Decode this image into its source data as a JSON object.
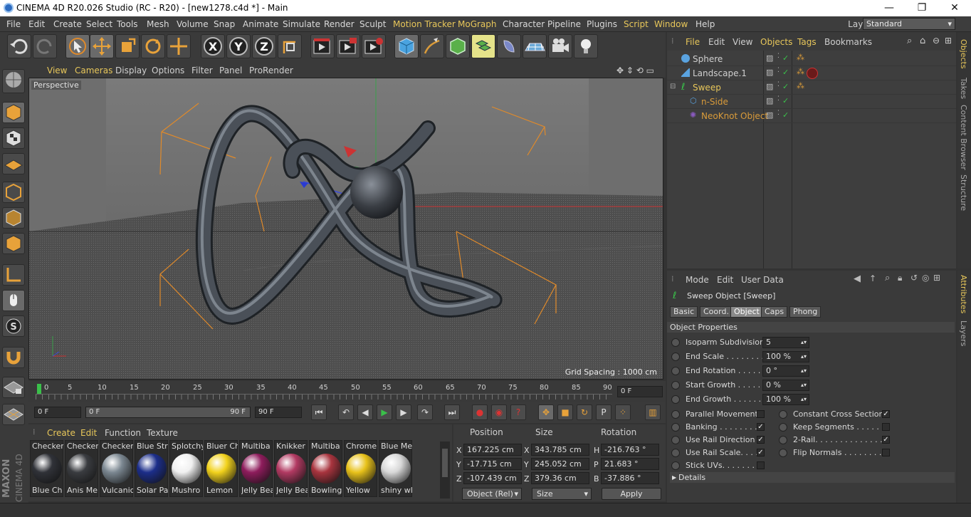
{
  "window": {
    "title": "CINEMA 4D R20.026 Studio (RC - R20) - [new1278.c4d *] - Main",
    "minimize": "—",
    "maximize": "❐",
    "close": "✕"
  },
  "menubar": {
    "items": [
      "File",
      "Edit",
      "Create",
      "Select",
      "Tools",
      "Mesh",
      "Volume",
      "Snap",
      "Animate",
      "Simulate",
      "Render",
      "Sculpt",
      "Motion Tracker",
      "MoGraph",
      "Character",
      "Pipeline",
      "Plugins",
      "Script",
      "Window",
      "Help"
    ],
    "layout_label": "Layout:",
    "layout_value": "Standard"
  },
  "viewport": {
    "menu": [
      "View",
      "Cameras",
      "Display",
      "Options",
      "Filter",
      "Panel",
      "ProRender"
    ],
    "camera_label": "Perspective",
    "grid_spacing": "Grid Spacing : 1000 cm"
  },
  "timeline": {
    "ticks": [
      "0",
      "5",
      "10",
      "15",
      "20",
      "25",
      "30",
      "35",
      "40",
      "45",
      "50",
      "55",
      "60",
      "65",
      "70",
      "75",
      "80",
      "85",
      "90"
    ],
    "current_frame": "0 F"
  },
  "transport": {
    "start": "0 F",
    "range_start": "0 F",
    "range_end": "90 F",
    "end": "90 F"
  },
  "material_manager": {
    "menu": [
      "Create",
      "Edit",
      "Function",
      "Texture"
    ],
    "row1": [
      "Checker",
      "Checker",
      "Checker",
      "Blue Str",
      "Splotchy",
      "Bluer Ch",
      "Multiba",
      "Knikker",
      "Multiba",
      "Chrome",
      "Blue Me"
    ],
    "row2": [
      "Blue Ch",
      "Anis Me",
      "Vulcanic",
      "Solar Pa",
      "Mushro",
      "Lemon",
      "Jelly Bea",
      "Jelly Bea",
      "Bowling",
      "Yellow",
      "shiny wl"
    ],
    "colors": [
      "#303238",
      "#3a3c40",
      "#7b8791",
      "#1c2e8a",
      "#f0f0f0",
      "#f2d21c",
      "#8e1c5c",
      "#b23a62",
      "#a8343e",
      "#e8c21a",
      "#d8d8d8"
    ]
  },
  "coordinates": {
    "headers": {
      "position": "Position",
      "size": "Size",
      "rotation": "Rotation"
    },
    "rows": [
      {
        "axis": "X",
        "pos": "167.225 cm",
        "size_axis": "X",
        "size": "343.785 cm",
        "rot_axis": "H",
        "rot": "-216.763 °"
      },
      {
        "axis": "Y",
        "pos": "-17.715 cm",
        "size_axis": "Y",
        "size": "245.052 cm",
        "rot_axis": "P",
        "rot": "21.683 °"
      },
      {
        "axis": "Z",
        "pos": "-107.439 cm",
        "size_axis": "Z",
        "size": "379.36 cm",
        "rot_axis": "B",
        "rot": "-37.886 °"
      }
    ],
    "mode": "Object (Rel)",
    "size_mode": "Size",
    "apply": "Apply"
  },
  "object_manager": {
    "menu": [
      "File",
      "Edit",
      "View",
      "Objects",
      "Tags",
      "Bookmarks"
    ],
    "objects": [
      {
        "name": "Sphere"
      },
      {
        "name": "Landscape.1"
      },
      {
        "name": "Sweep"
      },
      {
        "name": "n-Side"
      },
      {
        "name": "NeoKnot Object"
      }
    ]
  },
  "attribute_manager": {
    "menu": [
      "Mode",
      "Edit",
      "User Data"
    ],
    "title": "Sweep Object [Sweep]",
    "tabs": [
      "Basic",
      "Coord.",
      "Object",
      "Caps",
      "Phong"
    ],
    "section": "Object Properties",
    "fields": [
      {
        "label": "Isoparm Subdivision",
        "value": "5"
      },
      {
        "label": "End Scale . . . . . . . . .",
        "value": "100 %"
      },
      {
        "label": "End Rotation . . . . . .",
        "value": "0 °"
      },
      {
        "label": "Start Growth . . . . . .",
        "value": "0 %"
      },
      {
        "label": "End Growth . . . . . . .",
        "value": "100 %"
      }
    ],
    "checks_left": [
      {
        "label": "Parallel Movement",
        "checked": false
      },
      {
        "label": "Banking . . . . . . . .",
        "checked": true
      },
      {
        "label": "Use Rail Direction",
        "checked": true
      },
      {
        "label": "Use Rail Scale. . . .",
        "checked": true
      },
      {
        "label": "Stick UVs. . . . . . .",
        "checked": false
      }
    ],
    "checks_right": [
      {
        "label": "Constant Cross Section",
        "checked": true
      },
      {
        "label": "Keep Segments . . . . . .",
        "checked": false
      },
      {
        "label": "2-Rail. . . . . . . . . . . . . .",
        "checked": true
      },
      {
        "label": "Flip Normals . . . . . . . . .",
        "checked": false
      }
    ],
    "details": "Details"
  },
  "side_tabs_top": [
    "Objects",
    "Takes",
    "Content Browser",
    "Structure"
  ],
  "side_tabs_bottom": [
    "Attributes",
    "Layers"
  ],
  "brand": {
    "maxon": "MAXON",
    "product": "CINEMA 4D"
  }
}
